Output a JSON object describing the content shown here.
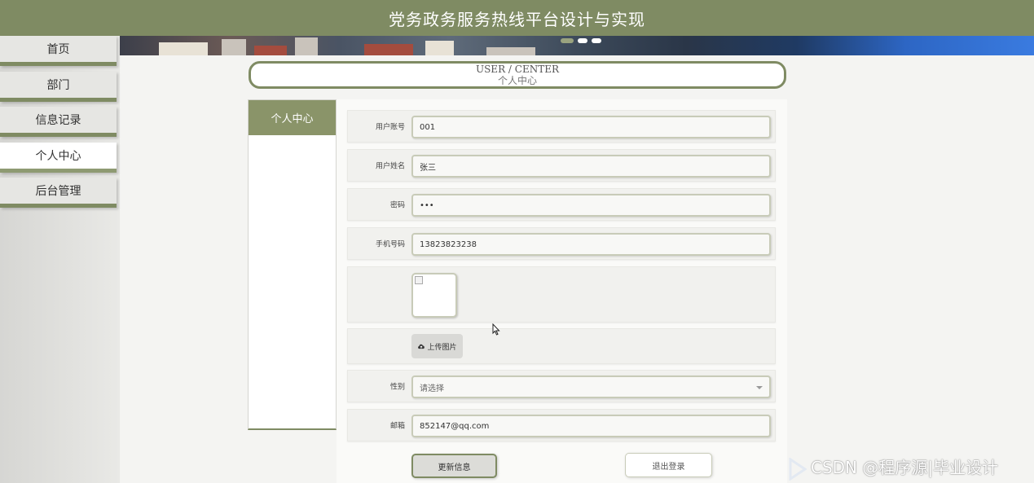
{
  "header": {
    "title": "党务政务服务热线平台设计与实现"
  },
  "sidebar": {
    "items": [
      {
        "label": "首页",
        "active": false
      },
      {
        "label": "部门",
        "active": false
      },
      {
        "label": "信息记录",
        "active": false
      },
      {
        "label": "个人中心",
        "active": true
      },
      {
        "label": "后台管理",
        "active": false
      }
    ]
  },
  "page_head": {
    "en": "USER / CENTER",
    "zh": "个人中心"
  },
  "left_panel": {
    "tab_label": "个人中心"
  },
  "form": {
    "account": {
      "label": "用户账号",
      "value": "001"
    },
    "name": {
      "label": "用户姓名",
      "value": "张三"
    },
    "password": {
      "label": "密码",
      "value": "•••"
    },
    "phone": {
      "label": "手机号码",
      "value": "13823823238"
    },
    "upload_label": "上传图片",
    "gender": {
      "label": "性别",
      "placeholder": "请选择"
    },
    "email": {
      "label": "邮箱",
      "value": "852147@qq.com"
    },
    "update_button": "更新信息",
    "logout_button": "退出登录"
  },
  "watermark": "CSDN @程序源|毕业设计",
  "colors": {
    "accent": "#7f8b63",
    "tab": "#8a9469",
    "topbar": "#7f8b63"
  }
}
